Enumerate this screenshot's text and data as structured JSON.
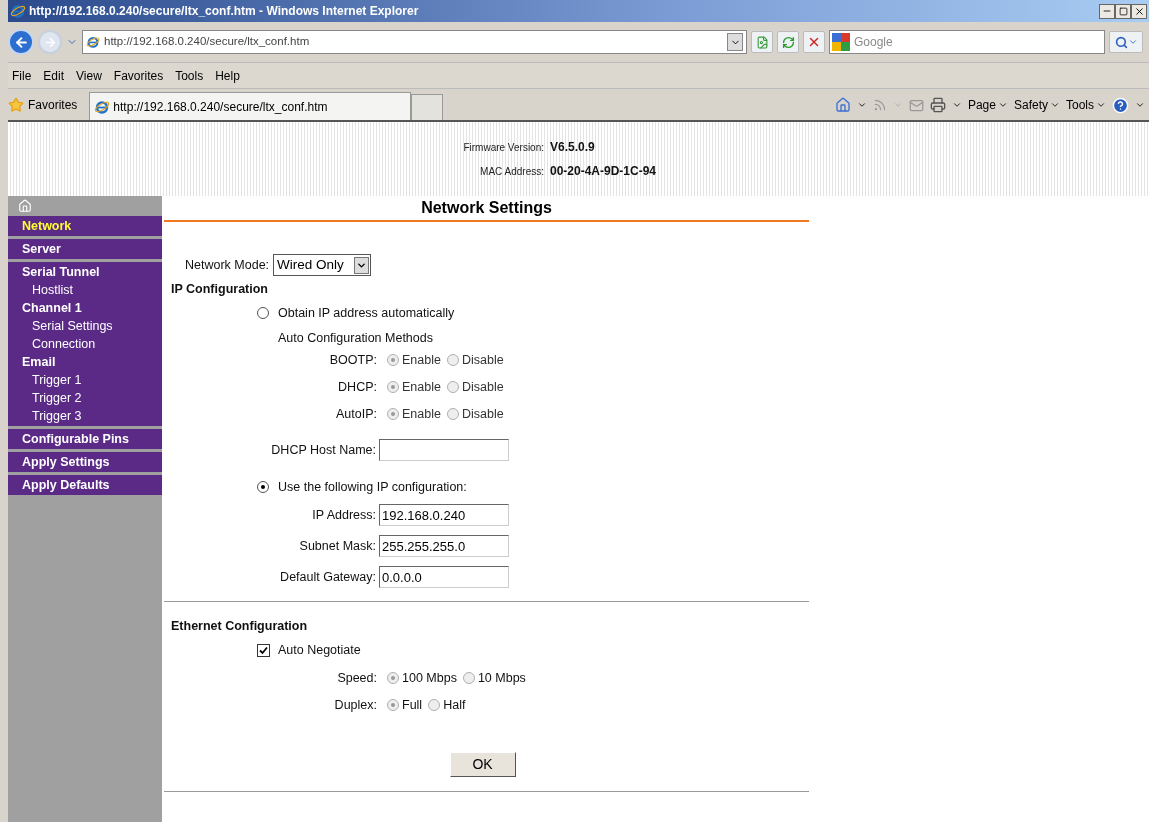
{
  "window": {
    "title": "http://192.168.0.240/secure/ltx_conf.htm - Windows Internet Explorer"
  },
  "address_bar": {
    "value": "http://192.168.0.240/secure/ltx_conf.htm"
  },
  "search": {
    "placeholder": "Google"
  },
  "menu": [
    "File",
    "Edit",
    "View",
    "Favorites",
    "Tools",
    "Help"
  ],
  "favorites_bar": {
    "label": "Favorites",
    "tab": "http://192.168.0.240/secure/ltx_conf.htm"
  },
  "command_bar": [
    "Page",
    "Safety",
    "Tools"
  ],
  "header": {
    "info": [
      {
        "label": "Firmware Version:",
        "value": "V6.5.0.9"
      },
      {
        "label": "MAC Address:",
        "value": "00-20-4A-9D-1C-94"
      }
    ]
  },
  "sidebar": {
    "groups": [
      [
        {
          "kind": "section",
          "label": "Network",
          "selected": true
        }
      ],
      [
        {
          "kind": "section",
          "label": "Server",
          "selected": false
        }
      ],
      [
        {
          "kind": "section",
          "label": "Serial Tunnel",
          "selected": false
        },
        {
          "kind": "sub",
          "label": "Hostlist",
          "selected": false
        },
        {
          "kind": "section",
          "label": "Channel 1",
          "selected": false
        },
        {
          "kind": "sub",
          "label": "Serial Settings",
          "selected": false
        },
        {
          "kind": "sub",
          "label": "Connection",
          "selected": false
        },
        {
          "kind": "section",
          "label": "Email",
          "selected": false
        },
        {
          "kind": "sub",
          "label": "Trigger 1",
          "selected": false
        },
        {
          "kind": "sub",
          "label": "Trigger 2",
          "selected": false
        },
        {
          "kind": "sub",
          "label": "Trigger 3",
          "selected": false
        }
      ],
      [
        {
          "kind": "section",
          "label": "Configurable Pins",
          "selected": false
        }
      ],
      [
        {
          "kind": "section",
          "label": "Apply Settings",
          "selected": false
        }
      ],
      [
        {
          "kind": "section",
          "label": "Apply Defaults",
          "selected": false
        }
      ]
    ]
  },
  "page": {
    "title": "Network Settings",
    "network_mode": {
      "label": "Network Mode:",
      "value": "Wired Only"
    },
    "ip_configuration": {
      "title": "IP Configuration",
      "obtain": {
        "label": "Obtain IP address automatically",
        "selected": false
      },
      "auto_methods": {
        "title": "Auto Configuration Methods",
        "disabled": true,
        "rows": [
          {
            "label": "BOOTP:",
            "options": [
              {
                "label": "Enable",
                "selected": true
              },
              {
                "label": "Disable",
                "selected": false
              }
            ]
          },
          {
            "label": "DHCP:",
            "options": [
              {
                "label": "Enable",
                "selected": true
              },
              {
                "label": "Disable",
                "selected": false
              }
            ]
          },
          {
            "label": "AutoIP:",
            "options": [
              {
                "label": "Enable",
                "selected": true
              },
              {
                "label": "Disable",
                "selected": false
              }
            ]
          }
        ]
      },
      "host_name": {
        "label": "DHCP Host Name:"
      },
      "manual": {
        "label": "Use the following IP configuration:",
        "selected": true
      },
      "fields": [
        {
          "label": "IP Address:",
          "value": "192.168.0.240"
        },
        {
          "label": "Subnet Mask:",
          "value": "255.255.255.0"
        },
        {
          "label": "Default Gateway:",
          "value": "0.0.0.0"
        }
      ]
    },
    "ethernet": {
      "title": "Ethernet Configuration",
      "auto_negotiate": {
        "label": "Auto Negotiate",
        "checked": true
      },
      "disabled": true,
      "rows": [
        {
          "label": "Speed:",
          "options": [
            {
              "label": "100 Mbps",
              "selected": true
            },
            {
              "label": "10 Mbps",
              "selected": false
            }
          ]
        },
        {
          "label": "Duplex:",
          "options": [
            {
              "label": "Full",
              "selected": true
            },
            {
              "label": "Half",
              "selected": false
            }
          ]
        }
      ]
    },
    "ok_button": "OK"
  }
}
